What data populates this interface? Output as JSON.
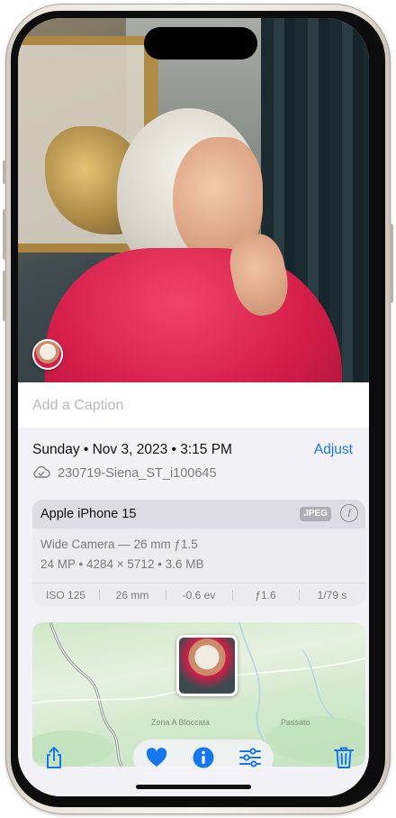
{
  "caption": {
    "placeholder": "Add a Caption"
  },
  "metadata": {
    "date_time": "Sunday • Nov 3, 2023 • 3:15 PM",
    "adjust_label": "Adjust",
    "file_name": "230719-Siena_ST_i100645",
    "icons": {
      "file": "cloud-check-icon"
    }
  },
  "camera": {
    "device": "Apple iPhone 15",
    "format_badge": "JPEG",
    "aperture_icon": "f",
    "lens": "Wide Camera — 26 mm ƒ1.5",
    "specs": "24 MP • 4284 × 5712 • 3.6 MB",
    "exif": [
      "ISO 125",
      "26 mm",
      "-0.6 ev",
      "ƒ1.6",
      "1/79 s"
    ]
  },
  "map": {
    "labels": [
      "Zona A Bloccata",
      "Passato"
    ]
  },
  "toolbar": {
    "icons": [
      "share-icon",
      "heart-icon",
      "info-icon",
      "sliders-icon",
      "trash-icon"
    ]
  },
  "colors": {
    "accent": "#1577f0",
    "sheet_bg": "#f2f2f6",
    "shirt": "#d51e4a"
  }
}
